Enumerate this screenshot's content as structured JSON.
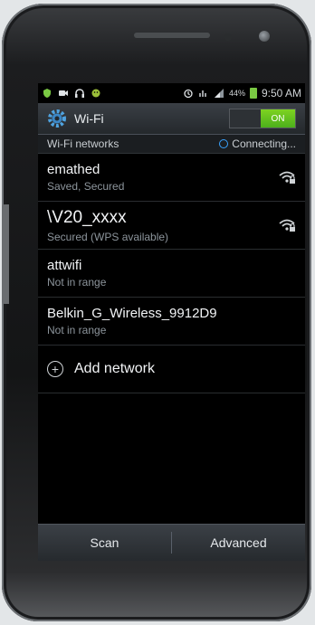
{
  "status_bar": {
    "battery": "44%",
    "time": "9:50 AM"
  },
  "header": {
    "title": "Wi-Fi",
    "toggle_label": "ON"
  },
  "section": {
    "title": "Wi-Fi networks",
    "status": "Connecting..."
  },
  "networks": [
    {
      "name": "emathed",
      "status": "Saved, Secured"
    },
    {
      "name": "\\V20_xxxx",
      "status": "Secured (WPS available)"
    },
    {
      "name": "attwifi",
      "status": "Not in range"
    },
    {
      "name": "Belkin_G_Wireless_9912D9",
      "status": "Not in range"
    }
  ],
  "add_network": {
    "label": "Add network"
  },
  "bottom": {
    "scan_label": "Scan",
    "advanced_label": "Advanced"
  },
  "colors": {
    "accent_on": "#7ed321",
    "accent_connect": "#39a3ff"
  },
  "icons": [
    "shield-icon",
    "video-icon",
    "headphones-icon",
    "android-icon",
    "alarm-icon",
    "network-icon",
    "signal-icon",
    "battery-icon",
    "gear-icon",
    "wifi-lock-icon",
    "plus-icon"
  ]
}
